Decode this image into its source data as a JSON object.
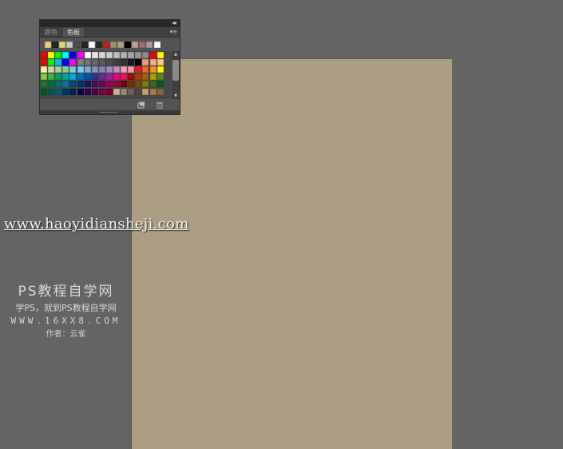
{
  "panel": {
    "tabs": [
      {
        "label": "颜色",
        "active": false
      },
      {
        "label": "色板",
        "active": true
      }
    ],
    "collapse_icon": "double-chevron-right-icon",
    "menu_icon": "panel-menu-icon",
    "footer": {
      "new_icon": "new-swatch-icon",
      "delete_icon": "trash-icon"
    },
    "recent_swatches": [
      "#e8d27a",
      "#262626",
      "#e8d27a",
      "#c8c8c8",
      "#4d4d4d",
      "#262626",
      "#ffffff",
      "#2b2b2b",
      "#c81e1e",
      "#9e8d6e",
      "#ab9e82",
      "#000000",
      "#b3a892",
      "#a66a7a",
      "#b8929e",
      "#ffffff"
    ],
    "swatch_rows": [
      [
        "#ff0000",
        "#ffff00",
        "#00ff00",
        "#00ffff",
        "#0000ff",
        "#ff00ff",
        "#ffffff",
        "#e8e8e8",
        "#d9d9d9",
        "#cccccc",
        "#bfbfbf",
        "#b3b3b3",
        "#a6a6a6",
        "#999999",
        "#8c8c8c",
        "#ff0000",
        "#ffff00"
      ],
      [
        "#ff0000",
        "#00ff00",
        "#00c0ff",
        "#0000ff",
        "#ff00ff",
        "#808080",
        "#737373",
        "#666666",
        "#595959",
        "#4d4d4d",
        "#404040",
        "#333333",
        "#1a1a1a",
        "#000000",
        "#f7977a",
        "#f9ad81",
        "#fdc68a"
      ],
      [
        "#fff79a",
        "#c4df9b",
        "#a2d39c",
        "#82ca9d",
        "#7bcdc8",
        "#6ecff6",
        "#7ea7d8",
        "#8493ca",
        "#8882be",
        "#a187be",
        "#bc8dbf",
        "#f49ac2",
        "#f6989d",
        "#ed1c24",
        "#f26522",
        "#f7941d",
        "#fff200"
      ],
      [
        "#8dc73f",
        "#39b54a",
        "#00a651",
        "#00a99d",
        "#00aeef",
        "#0072bc",
        "#0054a6",
        "#2e3192",
        "#662d91",
        "#92278f",
        "#ec008c",
        "#ed145b",
        "#9e0b0f",
        "#a0410d",
        "#a36209",
        "#aba000",
        "#598527"
      ],
      [
        "#1a7b30",
        "#007236",
        "#00746b",
        "#0076a3",
        "#004b80",
        "#003471",
        "#1b1464",
        "#440e62",
        "#630460",
        "#9e005d",
        "#9e0039",
        "#790000",
        "#7b2e00",
        "#7d4900",
        "#827b00",
        "#406618",
        "#005e20"
      ],
      [
        "#005826",
        "#005952",
        "#005b7f",
        "#003663",
        "#002157",
        "#0d004c",
        "#32004b",
        "#4b0049",
        "#7b0046",
        "#7a0026",
        "#c7b299",
        "#998675",
        "#736357",
        "#534741",
        "#c69c6d",
        "#a67c52",
        "#8c6239"
      ]
    ]
  },
  "watermark": {
    "url": "www.haoyidiansheji.com",
    "title": "PS教程自学网",
    "slogan": "学PS，就到PS教程自学网",
    "site": "WWW.16XX8.COM",
    "author": "作者：云雀"
  },
  "colors": {
    "workspace": "#646464",
    "canvas": "#ab9e82",
    "panel_bg": "#535353"
  }
}
